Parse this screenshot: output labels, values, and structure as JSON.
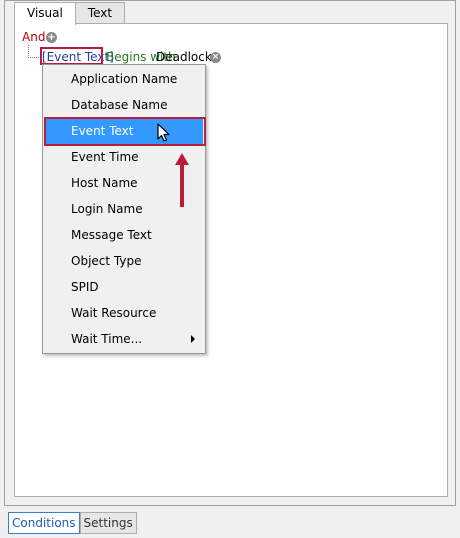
{
  "tabs": [
    {
      "label": "Visual",
      "active": true
    },
    {
      "label": "Text",
      "active": false
    }
  ],
  "condition": {
    "logic": "And",
    "field": "[Event Text]",
    "operator": "Begins with",
    "value": "Deadlock"
  },
  "menu": {
    "items": [
      {
        "label": "Application Name"
      },
      {
        "label": "Database Name"
      },
      {
        "label": "Event Text",
        "selected": true
      },
      {
        "label": "Event Time"
      },
      {
        "label": "Host Name"
      },
      {
        "label": "Login Name"
      },
      {
        "label": "Message Text"
      },
      {
        "label": "Object Type"
      },
      {
        "label": "SPID"
      },
      {
        "label": "Wait Resource"
      },
      {
        "label": "Wait Time...",
        "submenu": true
      }
    ]
  },
  "bottom_tabs": [
    {
      "label": "Conditions",
      "active": true
    },
    {
      "label": "Settings",
      "active": false
    }
  ],
  "colors": {
    "highlight_outline": "#b81e3c",
    "selected_bg": "#3399ff",
    "logic_text": "#c00000",
    "field_text": "#1f3f9f",
    "operator_text": "#217821"
  },
  "icons": {
    "add": "plus-circle-icon",
    "remove": "x-circle-icon",
    "pointer": "mouse-cursor-icon",
    "annotation": "red-up-arrow-icon"
  }
}
